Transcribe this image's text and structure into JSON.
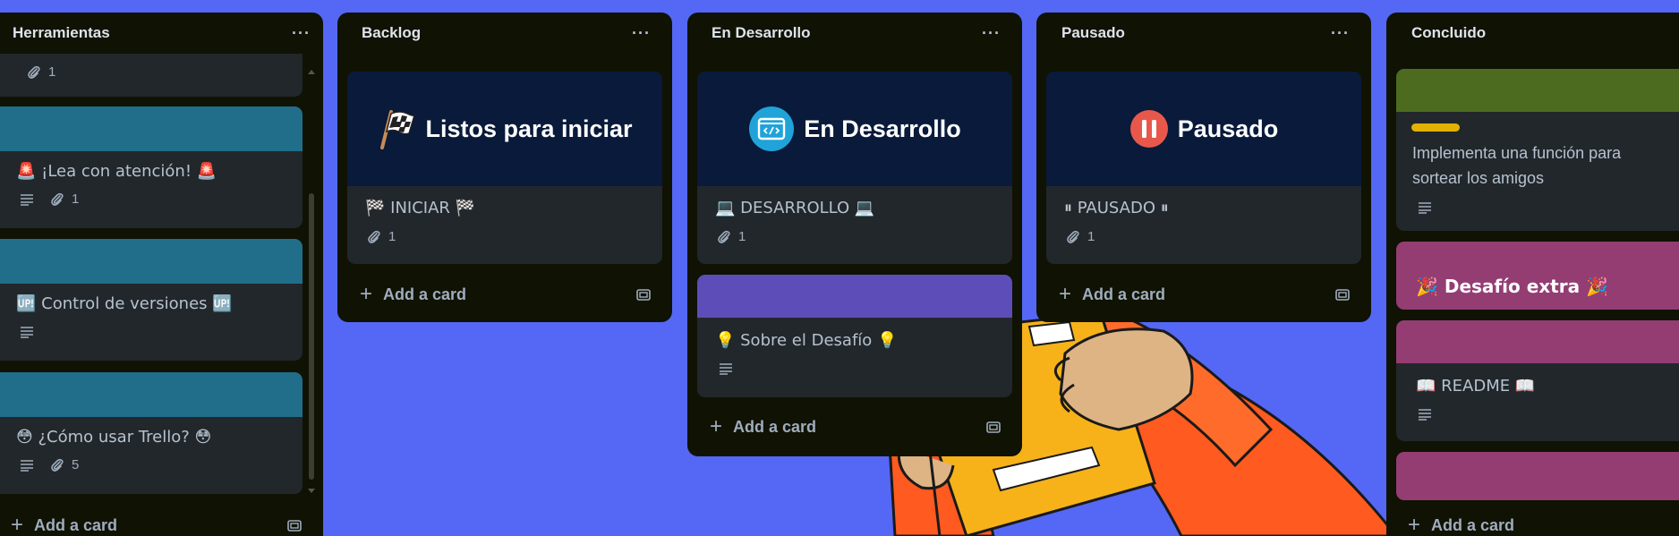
{
  "lists": [
    {
      "title": "Herramientas",
      "cards": [
        {
          "attachments": "1"
        },
        {
          "title": "🚨 ¡Lea con atención! 🚨",
          "attachments": "1"
        },
        {
          "title": "🆙 Control de versiones 🆙"
        },
        {
          "title": "😳 ¿Cómo usar Trello? 😳",
          "attachments": "5"
        }
      ],
      "add_card": "Add a card"
    },
    {
      "title": "Backlog",
      "cards": [
        {
          "cover_text": "Listos para iniciar",
          "cover_icon": "checkered-flag-icon",
          "title": "🏁 INICIAR 🏁",
          "attachments": "1"
        }
      ],
      "add_card": "Add a card"
    },
    {
      "title": "En Desarrollo",
      "cards": [
        {
          "cover_text": "En Desarrollo",
          "cover_icon": "code-window-icon",
          "title": "💻 DESARROLLO 💻",
          "attachments": "1"
        },
        {
          "title": "💡 Sobre el Desafío 💡"
        }
      ],
      "add_card": "Add a card"
    },
    {
      "title": "Pausado",
      "cards": [
        {
          "cover_text": "Pausado",
          "cover_icon": "pause-icon",
          "title": "⏸ PAUSADO ⏸",
          "attachments": "1"
        }
      ],
      "add_card": "Add a card"
    },
    {
      "title": "Concluido",
      "cards": [
        {
          "title": "Implementa una función para sortear los amigos",
          "title_line1": "Implementa una función para",
          "title_line2": "sortear los amigos"
        },
        {
          "title": "🎉 Desafío extra 🎉"
        },
        {
          "title": "📖 README 📖"
        }
      ],
      "add_card": "Add a card"
    }
  ],
  "colors": {
    "board_bg": "#5468f5",
    "list_bg": "#101204",
    "card_bg": "#22272b",
    "teal_cover": "#216e8a",
    "navy_cover": "#091a3a",
    "purple_cover": "#5d4db8",
    "green_cover": "#4c6b1f",
    "magenta_cover": "#943d73",
    "yellow_label": "#e2b203"
  }
}
